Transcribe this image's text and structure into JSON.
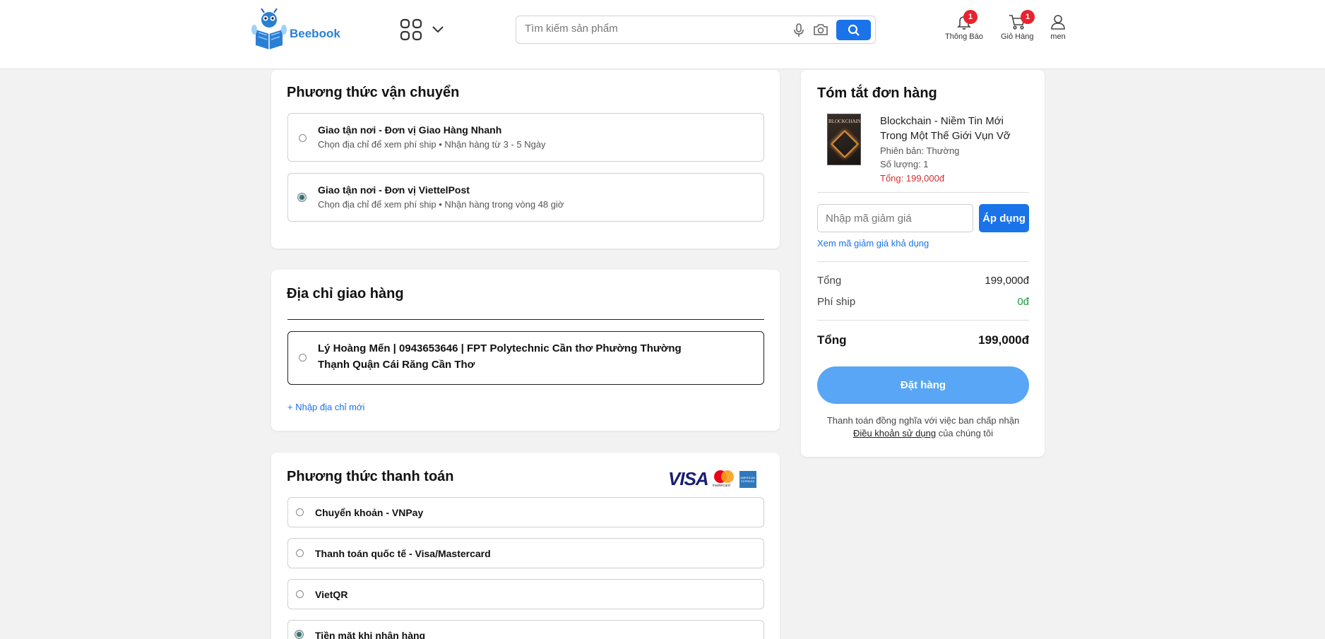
{
  "header": {
    "logo_text": "Beebook",
    "search_placeholder": "Tìm kiếm sản phẩm",
    "notifications": {
      "label": "Thông Báo",
      "count": "1"
    },
    "cart": {
      "label": "Giỏ Hàng",
      "count": "1"
    },
    "user": {
      "label": "men"
    }
  },
  "shipping": {
    "title": "Phương thức vận chuyển",
    "options": [
      {
        "title": "Giao tận nơi - Đơn vị Giao Hàng Nhanh",
        "subtitle": "Chọn địa chỉ để xem phí ship • Nhận hàng từ 3 - 5 Ngày",
        "selected": false
      },
      {
        "title": "Giao tận nơi - Đơn vị ViettelPost",
        "subtitle": "Chọn địa chỉ để xem phí ship • Nhận hàng trong vòng 48 giờ",
        "selected": true
      }
    ]
  },
  "address": {
    "title": "Địa chỉ giao hàng",
    "line1": "Lý Hoàng Mến | 0943653646 | FPT Polytechnic Cần thơ Phường Thường",
    "line2": "Thạnh Quận Cái Răng Cần Thơ",
    "add_new": "+ Nhập địa chỉ mới"
  },
  "payment": {
    "title": "Phương thức thanh toán",
    "card_brands": [
      "VISA",
      "mastercard",
      "AMERICAN EXPRESS"
    ],
    "options": [
      {
        "label": "Chuyển khoản - VNPay",
        "selected": false
      },
      {
        "label": "Thanh toán quốc tế - Visa/Mastercard",
        "selected": false
      },
      {
        "label": "VietQR",
        "selected": false
      },
      {
        "label": "Tiền mặt khi nhận hàng",
        "selected": true
      }
    ]
  },
  "summary": {
    "title": "Tóm tắt đơn hàng",
    "product": {
      "cover_text": "BLOCKCHAIN",
      "name_line1": "Blockchain - Niềm Tin Mới",
      "name_line2": "Trong Một Thế Giới Vụn Vỡ",
      "edition": "Phiên bản: Thường",
      "quantity": "Số lượng: 1",
      "total": "Tổng: 199,000đ"
    },
    "coupon_placeholder": "Nhập mã giảm giá",
    "apply_label": "Áp dụng",
    "view_coupons": "Xem mã giảm giá khả dụng",
    "subtotal_label": "Tổng",
    "subtotal_value": "199,000đ",
    "shipping_label": "Phí ship",
    "shipping_value": "0đ",
    "total_label": "Tổng",
    "total_value": "199,000đ",
    "order_button": "Đặt hàng",
    "terms_line1": "Thanh toán đồng nghĩa với việc ban chấp nhận",
    "terms_link": "Điều khoản sử dụng",
    "terms_suffix": "của chúng tôi"
  },
  "colors": {
    "primary": "#1a73e8",
    "order_button": "#58a6f5",
    "price_red": "#d32f2f",
    "free_green": "#1a9c3c",
    "badge": "#e8232e"
  }
}
